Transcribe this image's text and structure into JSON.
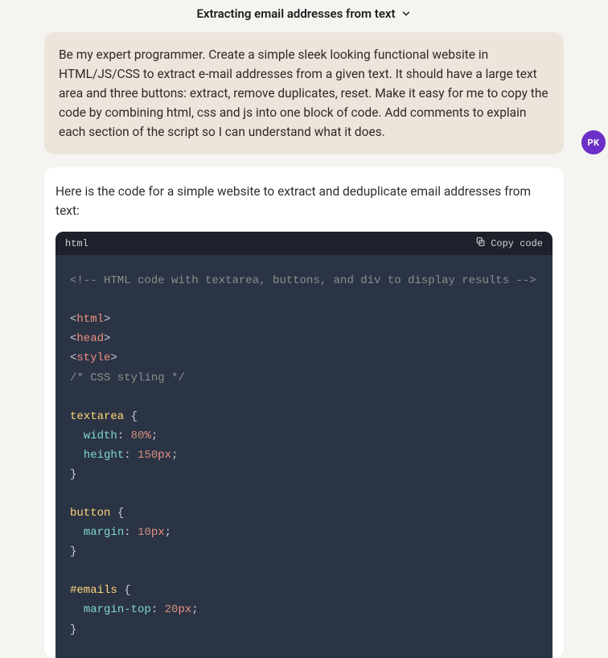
{
  "header": {
    "title": "Extracting email addresses from text"
  },
  "user": {
    "message": "Be my expert programmer. Create a simple sleek looking functional website in HTML/JS/CSS to extract e-mail addresses from a given text. It should have a large text area and three buttons: extract, remove duplicates, reset. Make it easy for me to copy the code by combining html, css and js into one block of code. Add comments to explain each section of the script so I can understand what it does.",
    "avatar_initials": "PK"
  },
  "assistant": {
    "intro": "Here is the code for a simple website to extract and deduplicate email addresses from text:",
    "code_lang": "html",
    "copy_label": "Copy code",
    "code": {
      "comment_top": "<!-- HTML code with textarea, buttons, and div to display results -->",
      "tag_html": "html",
      "tag_head": "head",
      "tag_style": "style",
      "comment_css": "/* CSS styling */",
      "rules": [
        {
          "selector": "textarea",
          "decls": [
            {
              "prop": "width",
              "num": "80",
              "unit": "%"
            },
            {
              "prop": "height",
              "num": "150",
              "unit": "px"
            }
          ]
        },
        {
          "selector": "button",
          "decls": [
            {
              "prop": "margin",
              "num": "10",
              "unit": "px"
            }
          ]
        },
        {
          "selector": "#emails",
          "decls": [
            {
              "prop": "margin-top",
              "num": "20",
              "unit": "px"
            }
          ]
        }
      ]
    }
  }
}
